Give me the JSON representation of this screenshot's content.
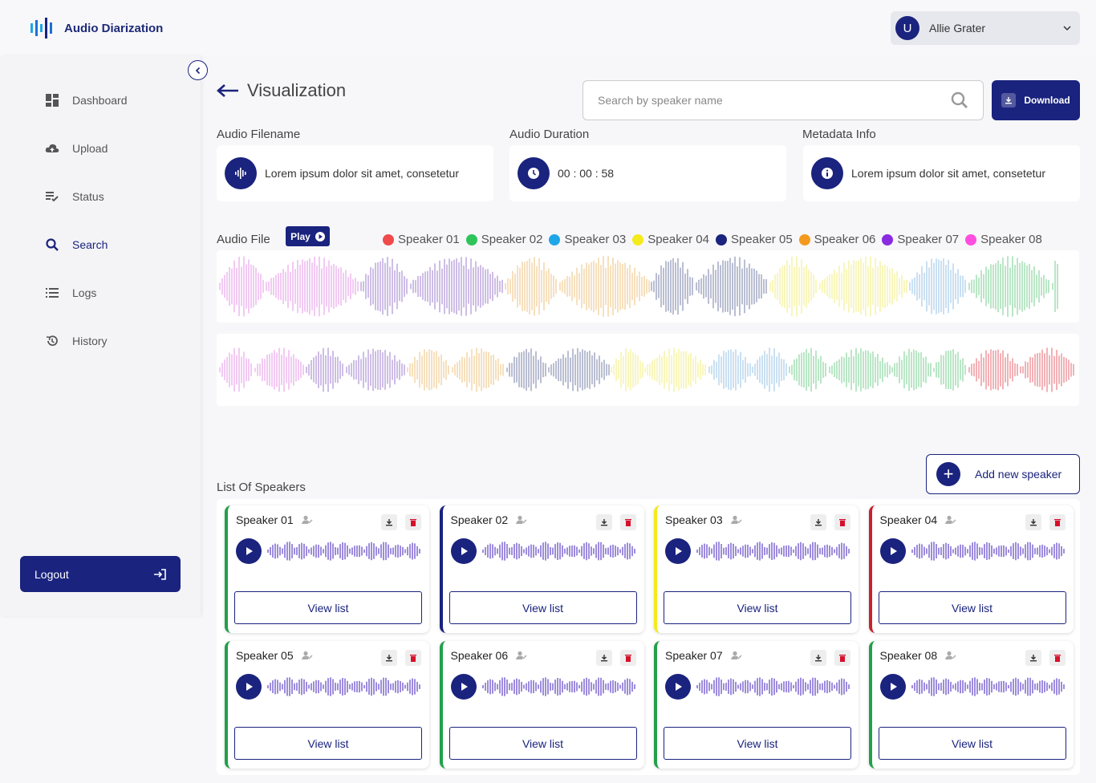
{
  "app": {
    "title": "Audio Diarization"
  },
  "user": {
    "initial": "U",
    "name": "Allie Grater"
  },
  "sidebar": {
    "items": [
      {
        "label": "Dashboard",
        "icon": "dashboard-icon"
      },
      {
        "label": "Upload",
        "icon": "upload-icon"
      },
      {
        "label": "Status",
        "icon": "status-icon"
      },
      {
        "label": "Search",
        "icon": "search-icon",
        "active": true
      },
      {
        "label": "Logs",
        "icon": "logs-icon"
      },
      {
        "label": "History",
        "icon": "history-icon"
      }
    ],
    "logout_label": "Logout"
  },
  "page": {
    "title": "Visualization"
  },
  "search": {
    "placeholder": "Search by speaker name"
  },
  "download_label": "Download",
  "info": {
    "filename_label": "Audio Filename",
    "filename_value": "Lorem ipsum dolor sit amet, consetetur",
    "duration_label": "Audio Duration",
    "duration_value": "00 : 00 : 58",
    "metadata_label": "Metadata Info",
    "metadata_value": "Lorem ipsum dolor sit amet, consetetur"
  },
  "audio_file": {
    "label": "Audio File",
    "play_label": "Play",
    "legend": [
      {
        "name": "Speaker 01",
        "color": "#f04a4a"
      },
      {
        "name": "Speaker 02",
        "color": "#2ec45a"
      },
      {
        "name": "Speaker 03",
        "color": "#1ea7e8"
      },
      {
        "name": "Speaker 04",
        "color": "#f4ea1e"
      },
      {
        "name": "Speaker 05",
        "color": "#1a237e"
      },
      {
        "name": "Speaker 06",
        "color": "#f39a1e"
      },
      {
        "name": "Speaker 07",
        "color": "#8a2be2"
      },
      {
        "name": "Speaker 08",
        "color": "#ff4ee0"
      }
    ]
  },
  "speakers": {
    "title": "List Of Speakers",
    "add_label": "Add new speaker",
    "view_label": "View list",
    "cards": [
      {
        "name": "Speaker 01",
        "border": "#22a04a"
      },
      {
        "name": "Speaker 02",
        "border": "#1a237e"
      },
      {
        "name": "Speaker 03",
        "border": "#f4ea1e"
      },
      {
        "name": "Speaker 04",
        "border": "#c8222e"
      },
      {
        "name": "Speaker 05",
        "border": "#22a04a"
      },
      {
        "name": "Speaker 06",
        "border": "#22a04a"
      },
      {
        "name": "Speaker 07",
        "border": "#22a04a"
      },
      {
        "name": "Speaker 08",
        "border": "#22a04a"
      }
    ]
  }
}
